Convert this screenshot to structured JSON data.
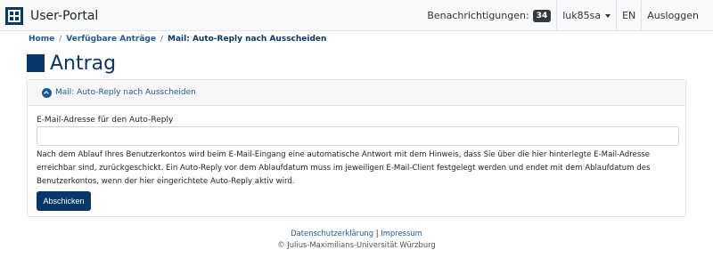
{
  "header": {
    "brand": "User-Portal",
    "notifications_label": "Benachrichtigungen:",
    "notifications_count": "34",
    "user": "luk85sa",
    "language": "EN",
    "logout": "Ausloggen"
  },
  "breadcrumb": {
    "home": "Home",
    "sep": "/",
    "section": "Verfügbare Anträge",
    "current": "Mail: Auto-Reply nach Ausscheiden"
  },
  "page": {
    "title": "Antrag"
  },
  "card": {
    "header": "Mail: Auto-Reply nach Ausscheiden",
    "field_label": "E-Mail-Adresse für den Auto-Reply",
    "field_value": "",
    "help_text": "Nach dem Ablauf Ihres Benutzerkontos wird beim E-Mail-Eingang eine automatische Antwort mit dem Hinweis, dass Sie über die hier hinterlegte E-Mail-Adresse erreichbar sind, zurückgeschickt. Ein Auto-Reply vor dem Ablaufdatum muss im jeweiligen E-Mail-Client festgelegt werden und endet mit dem Ablaufdatum des Benutzerkontos, wenn der hier eingerichtete Auto-Reply aktiv wird.",
    "submit": "Abschicken"
  },
  "footer": {
    "privacy": "Datenschutzerklärung",
    "divider": "|",
    "imprint": "Impressum",
    "copyright": "© Julius-Maximilians-Universität Würzburg"
  },
  "colors": {
    "brand": "#08386b",
    "link": "#1a5a99",
    "navbar_bg": "#f8f9fa"
  },
  "icons": {
    "logo": "university-logo-icon",
    "caret": "caret-down-icon",
    "collapse": "chevron-up-circle-icon",
    "title": "square-icon"
  }
}
